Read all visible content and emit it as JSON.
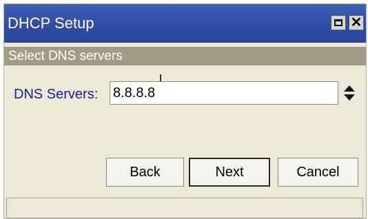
{
  "window": {
    "title": "DHCP Setup",
    "title_bar_buttons": [
      "restore-icon",
      "close-icon"
    ]
  },
  "section": {
    "heading": "Select DNS servers"
  },
  "form": {
    "dns_label": "DNS Servers:",
    "dns_value": "8.8.8.8",
    "spinner_icon": "up-down-arrows-icon"
  },
  "buttons": {
    "back": "Back",
    "next": "Next",
    "cancel": "Cancel"
  },
  "colors": {
    "title_bar": "#2f4ea6",
    "section_band": "#a39b86",
    "label_text": "#1a1aa8",
    "window_background": "#ece9d8"
  }
}
